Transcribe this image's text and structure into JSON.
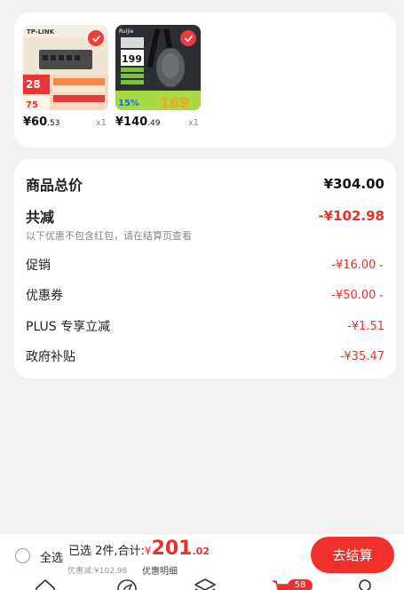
{
  "products": [
    {
      "brand": "TP-LINK",
      "promo_badge": "28",
      "promo_price": "75",
      "price_int": "¥60",
      "price_dec": ".53",
      "qty": "x1",
      "thumb_color": "#e8dcc8"
    },
    {
      "brand": "Ruijie",
      "promo_price": "199",
      "promo_percent": "15%",
      "promo_final": "169",
      "price_int": "¥140",
      "price_dec": ".49",
      "qty": "x1",
      "thumb_color": "#2a2d31"
    }
  ],
  "summary": {
    "total_label": "商品总价",
    "total_value": "¥304.00",
    "reduce_label": "共减",
    "reduce_value": "-¥102.98",
    "note": "以下优惠不包含红包，请在结算页查看",
    "items": [
      {
        "label": "促销",
        "value": "-¥16.00",
        "expandable": true
      },
      {
        "label": "优惠券",
        "value": "-¥50.00",
        "expandable": true
      },
      {
        "label": "PLUS 专享立减",
        "value": "-¥1.51",
        "expandable": false
      },
      {
        "label": "政府补贴",
        "value": "-¥35.47",
        "expandable": false
      }
    ]
  },
  "bottom": {
    "select_all": "全选",
    "selected_info": "已选 2件,合计:",
    "currency": "¥",
    "total_int": "201",
    "total_dec": ".02",
    "discount_text": "优惠减:¥102.98",
    "detail_link": "优惠明细",
    "checkout_label": "去结算"
  },
  "cart_badge": "58",
  "colors": {
    "accent": "#f0302a",
    "price_red": "#e8312c"
  }
}
